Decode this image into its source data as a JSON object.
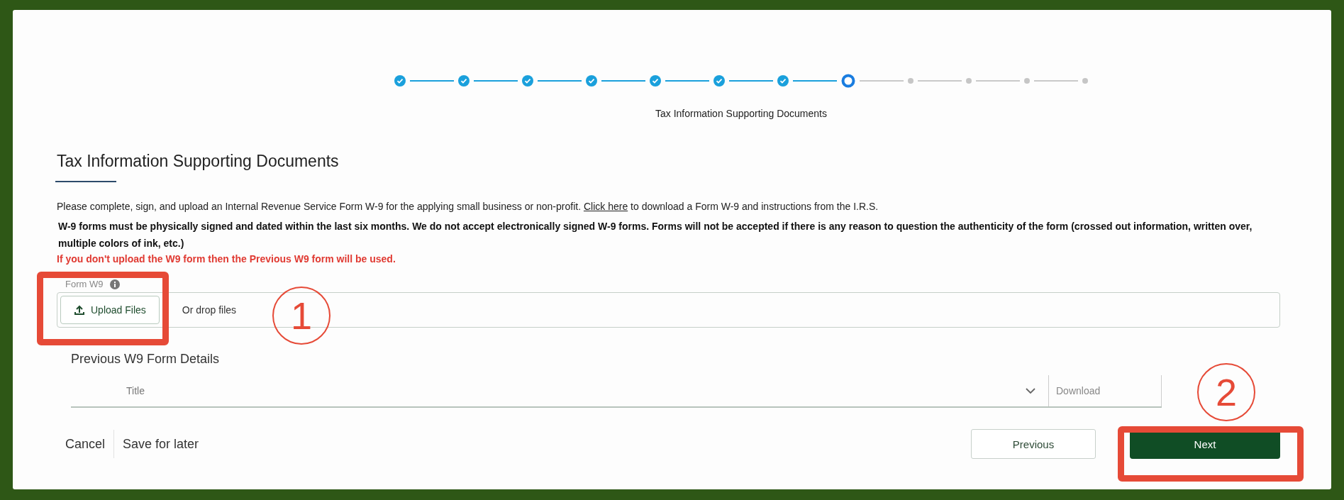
{
  "stepper": {
    "steps": [
      {
        "kind": "done"
      },
      {
        "kind": "done"
      },
      {
        "kind": "done"
      },
      {
        "kind": "done"
      },
      {
        "kind": "done"
      },
      {
        "kind": "done"
      },
      {
        "kind": "done"
      },
      {
        "kind": "current",
        "label": "Tax Information Supporting Documents"
      },
      {
        "kind": "upcoming"
      },
      {
        "kind": "upcoming"
      },
      {
        "kind": "upcoming"
      },
      {
        "kind": "upcoming"
      }
    ]
  },
  "heading": "Tax Information Supporting Documents",
  "intro": {
    "before": "Please complete, sign, and upload an Internal Revenue Service Form W-9 for the applying small business or non-profit.",
    "link": "Click here",
    "after": "to download a Form W-9 and instructions from the I.R.S."
  },
  "notice": "W-9 forms must be physically signed and dated within the last six months. We do not accept electronically signed W-9 forms. Forms will not be accepted if there is any reason to question the authenticity of the form (crossed out information, written over, multiple colors of ink, etc.)",
  "warning": "If you don't upload the W9 form then the Previous W9 form will be used.",
  "upload": {
    "label": "Form W9",
    "button": "Upload Files",
    "hint": "Or drop files"
  },
  "previous": {
    "title": "Previous W9 Form Details",
    "columns": [
      "Title",
      "Download"
    ]
  },
  "footer": {
    "cancel": "Cancel",
    "save": "Save for later",
    "previous": "Previous",
    "next": "Next"
  },
  "annotations": [
    {
      "number": "1"
    },
    {
      "number": "2"
    }
  ]
}
